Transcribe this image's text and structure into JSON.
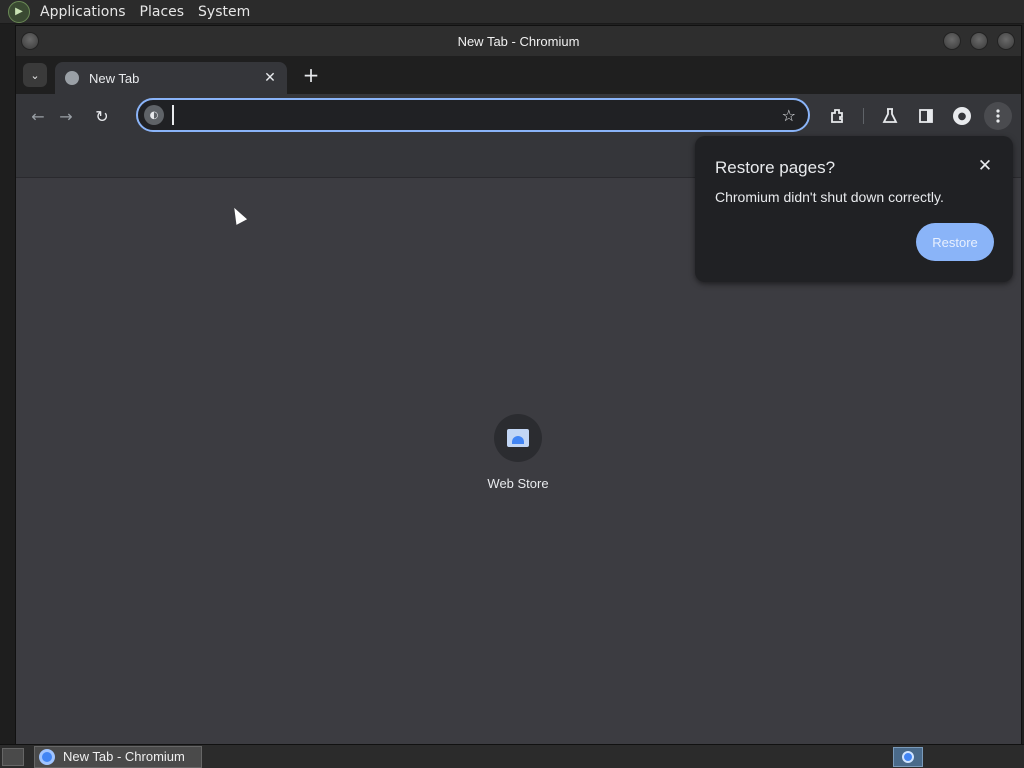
{
  "top_panel": {
    "menus": [
      "Applications",
      "Places",
      "System"
    ]
  },
  "window": {
    "title": "New Tab - Chromium"
  },
  "tabstrip": {
    "tabs": [
      {
        "title": "New Tab",
        "favicon": "globe-icon",
        "active": true
      }
    ],
    "new_tab_symbol": "+",
    "close_symbol": "✕",
    "tab_search_symbol": "⌄"
  },
  "toolbar": {
    "back_symbol": "←",
    "forward_symbol": "→",
    "reload_symbol": "↻",
    "omnibox": {
      "value": "",
      "placeholder": ""
    },
    "bookmark_star": "☆",
    "icons": [
      "extensions-icon",
      "labs-icon",
      "side-panel-icon",
      "profile-icon",
      "menu-icon"
    ]
  },
  "content": {
    "shortcuts": [
      {
        "label": "Web Store",
        "icon": "web-store-icon"
      }
    ]
  },
  "restore_bubble": {
    "title": "Restore pages?",
    "message": "Chromium didn't shut down correctly.",
    "button_label": "Restore",
    "close_symbol": "✕"
  },
  "taskbar": {
    "tasks": [
      {
        "label": "New Tab - Chromium",
        "icon": "chromium-icon"
      }
    ]
  },
  "colors": {
    "accent": "#8ab4f8",
    "content_bg": "#3c3c41",
    "bubble_bg": "#202124"
  }
}
